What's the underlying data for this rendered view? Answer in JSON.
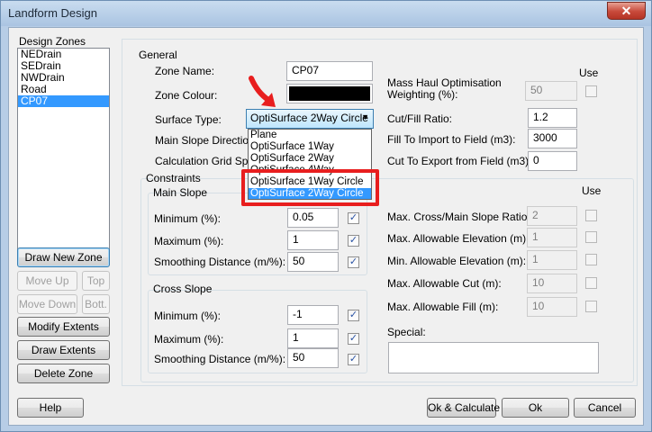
{
  "window": {
    "title": "Landform Design",
    "close_glyph": "✕"
  },
  "design_zones": {
    "title": "Design Zones",
    "items": [
      "NEDrain",
      "SEDrain",
      "NWDrain",
      "Road",
      "CP07"
    ],
    "selected": "CP07"
  },
  "left_buttons": {
    "draw_new_zone": "Draw New Zone",
    "move_up": "Move Up",
    "top": "Top",
    "move_down": "Move Down",
    "bottom": "Bott.",
    "modify_extents": "Modify Extents",
    "draw_extents": "Draw Extents",
    "delete_zone": "Delete Zone"
  },
  "general": {
    "title": "General",
    "zone_name_label": "Zone Name:",
    "zone_name": "CP07",
    "zone_colour_label": "Zone Colour:",
    "zone_colour": "#000000",
    "surface_type_label": "Surface Type:",
    "surface_type": "OptiSurface 2Way Circle",
    "main_slope_direction_label": "Main Slope Direction (",
    "calc_grid_label": "Calculation Grid Spaci",
    "surface_options": [
      "Plane",
      "OptiSurface 1Way",
      "OptiSurface 2Way",
      "OptiSurface 4Way",
      "OptiSurface 1Way Circle",
      "OptiSurface 2Way Circle"
    ],
    "mass_haul_label": "Mass Haul Optimisation Weighting (%):",
    "use_label": "Use",
    "mass_haul_value": "50",
    "cut_fill_label": "Cut/Fill Ratio:",
    "cut_fill": "1.2",
    "fill_import_label": "Fill To Import to Field (m3):",
    "fill_import": "3000",
    "cut_export_label": "Cut To Export from Field (m3):",
    "cut_export": "0"
  },
  "constraints": {
    "title": "Constraints",
    "use_label": "Use",
    "main_slope": {
      "title": "Main Slope",
      "minimum_label": "Minimum (%):",
      "minimum": "0.05",
      "maximum_label": "Maximum (%):",
      "maximum": "1",
      "smoothing_label": "Smoothing Distance (m/%):",
      "smoothing": "50"
    },
    "cross_slope": {
      "title": "Cross Slope",
      "minimum_label": "Minimum (%):",
      "minimum": "-1",
      "maximum_label": "Maximum (%):",
      "maximum": "1",
      "smoothing_label": "Smoothing Distance (m/%):",
      "smoothing": "50"
    },
    "right": {
      "ratio_label": "Max. Cross/Main Slope Ratio:",
      "ratio": "2",
      "max_elev_label": "Max. Allowable Elevation (m):",
      "max_elev": "1",
      "min_elev_label": "Min. Allowable Elevation (m):",
      "min_elev": "1",
      "max_cut_label": "Max. Allowable Cut (m):",
      "max_cut": "10",
      "max_fill_label": "Max. Allowable Fill (m):",
      "max_fill": "10",
      "special_label": "Special:"
    }
  },
  "checkbox_glyph": "✓",
  "footer": {
    "help": "Help",
    "ok_calculate": "Ok & Calculate",
    "ok": "Ok",
    "cancel": "Cancel"
  },
  "icons": {
    "annotation_arrow": "red-arrow-icon",
    "combo_arrow": "▼"
  }
}
